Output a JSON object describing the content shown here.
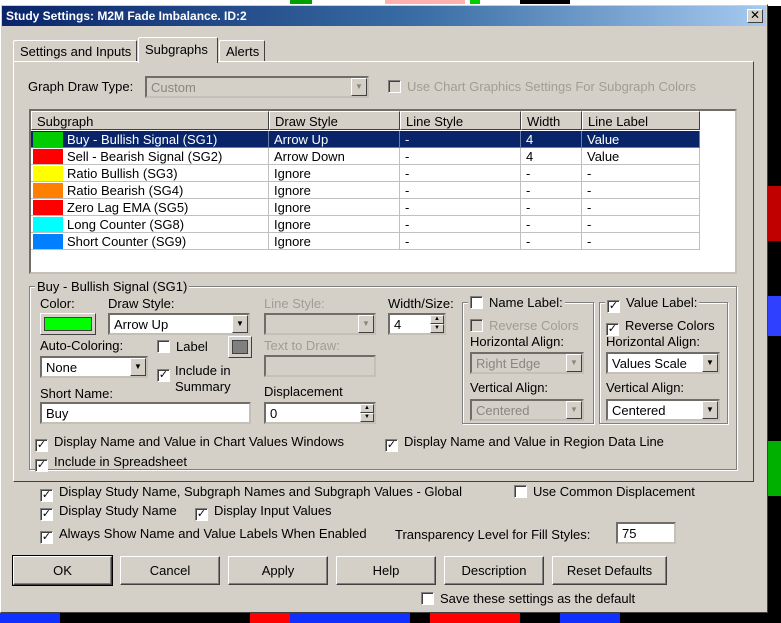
{
  "window": {
    "title": "Study Settings: M2M Fade Imbalance. ID:2",
    "close_glyph": "✕"
  },
  "tabs": [
    {
      "label": "Settings and Inputs",
      "active": false
    },
    {
      "label": "Subgraphs",
      "active": true
    },
    {
      "label": "Alerts",
      "active": false
    }
  ],
  "graph_draw_type": {
    "label": "Graph Draw Type:",
    "value": "Custom"
  },
  "use_chart_graphics": {
    "label": "Use Chart Graphics Settings For Subgraph Colors",
    "checked": false
  },
  "subgraph_table": {
    "columns": [
      "Subgraph",
      "Draw Style",
      "Line Style",
      "Width",
      "Line Label"
    ],
    "rows": [
      {
        "color": "#00cc00",
        "name": "Buy - Bullish Signal (SG1)",
        "draw_style": "Arrow Up",
        "line_style": "-",
        "width": "4",
        "line_label": "Value",
        "selected": true
      },
      {
        "color": "#ff0000",
        "name": "Sell - Bearish Signal (SG2)",
        "draw_style": "Arrow Down",
        "line_style": "-",
        "width": "4",
        "line_label": "Value",
        "selected": false
      },
      {
        "color": "#ffff00",
        "name": "Ratio Bullish (SG3)",
        "draw_style": "Ignore",
        "line_style": "-",
        "width": "-",
        "line_label": "-",
        "selected": false
      },
      {
        "color": "#ff8000",
        "name": "Ratio Bearish (SG4)",
        "draw_style": "Ignore",
        "line_style": "-",
        "width": "-",
        "line_label": "-",
        "selected": false
      },
      {
        "color": "#ff0000",
        "name": "Zero Lag EMA (SG5)",
        "draw_style": "Ignore",
        "line_style": "-",
        "width": "-",
        "line_label": "-",
        "selected": false
      },
      {
        "color": "#00ffff",
        "name": "Long Counter (SG8)",
        "draw_style": "Ignore",
        "line_style": "-",
        "width": "-",
        "line_label": "-",
        "selected": false
      },
      {
        "color": "#0080ff",
        "name": "Short Counter (SG9)",
        "draw_style": "Ignore",
        "line_style": "-",
        "width": "-",
        "line_label": "-",
        "selected": false
      }
    ]
  },
  "details": {
    "group_title": "Buy - Bullish Signal (SG1)",
    "color_label": "Color:",
    "color_value": "#00ff00",
    "draw_style_label": "Draw Style:",
    "draw_style_value": "Arrow Up",
    "line_style_label": "Line Style:",
    "line_style_value": "",
    "width_label": "Width/Size:",
    "width_value": "4",
    "auto_coloring_label": "Auto-Coloring:",
    "auto_coloring_value": "None",
    "label_check": {
      "label": "Label",
      "checked": false
    },
    "text_to_draw_label": "Text to Draw:",
    "include_summary": {
      "label_line1": "Include in",
      "label_line2": "Summary",
      "checked": true
    },
    "short_name_label": "Short Name:",
    "short_name_value": "Buy",
    "displacement_label": "Displacement",
    "displacement_value": "0",
    "name_label": {
      "label": "Name Label:",
      "checked": false,
      "reverse_colors": {
        "label": "Reverse Colors",
        "checked": false
      },
      "h_align_label": "Horizontal Align:",
      "h_align_value": "Right Edge",
      "v_align_label": "Vertical Align:",
      "v_align_value": "Centered"
    },
    "value_label": {
      "label": "Value Label:",
      "checked": true,
      "reverse_colors": {
        "label": "Reverse Colors",
        "checked": true
      },
      "h_align_label": "Horizontal Align:",
      "h_align_value": "Values Scale",
      "v_align_label": "Vertical Align:",
      "v_align_value": "Centered"
    },
    "display_chart_values": {
      "label": "Display Name and Value in Chart Values Windows",
      "checked": true
    },
    "display_region_data": {
      "label": "Display Name and Value in Region Data Line",
      "checked": true
    },
    "include_spreadsheet": {
      "label": "Include in Spreadsheet",
      "checked": true
    }
  },
  "global": {
    "display_global": {
      "label": "Display Study Name, Subgraph Names and Subgraph Values - Global",
      "checked": true
    },
    "use_common_displacement": {
      "label": "Use Common Displacement",
      "checked": false
    },
    "display_study_name": {
      "label": "Display Study Name",
      "checked": true
    },
    "display_input_values": {
      "label": "Display Input Values",
      "checked": true
    },
    "always_show_labels": {
      "label": "Always Show Name and Value Labels When Enabled",
      "checked": true
    },
    "transparency_label": "Transparency Level for Fill Styles:",
    "transparency_value": "75"
  },
  "buttons": {
    "ok": "OK",
    "cancel": "Cancel",
    "apply": "Apply",
    "help": "Help",
    "description": "Description",
    "reset_defaults": "Reset Defaults"
  },
  "save_default": {
    "label": "Save these settings as the default",
    "checked": false
  },
  "glyphs": {
    "check": "✓",
    "dropdown": "▼",
    "spin_up": "▲",
    "spin_down": "▼"
  }
}
